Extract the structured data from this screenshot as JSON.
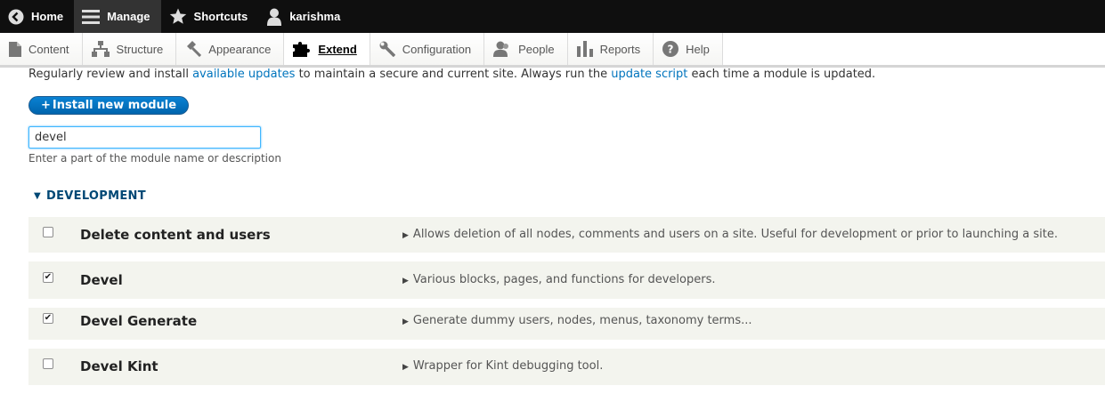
{
  "toolbar": {
    "home": "Home",
    "manage": "Manage",
    "shortcuts": "Shortcuts",
    "user": "karishma"
  },
  "tray": {
    "items": [
      {
        "label": "Content"
      },
      {
        "label": "Structure"
      },
      {
        "label": "Appearance"
      },
      {
        "label": "Extend"
      },
      {
        "label": "Configuration"
      },
      {
        "label": "People"
      },
      {
        "label": "Reports"
      },
      {
        "label": "Help"
      }
    ]
  },
  "main": {
    "desc_part1": "Regularly review and install ",
    "desc_link1": "available updates",
    "desc_part2": " to maintain a secure and current site. Always run the ",
    "desc_link2": "update script",
    "desc_part3": " each time a module is updated.",
    "install_label": "Install new module",
    "install_plus": "+",
    "filter_value": "devel",
    "filter_description": "Enter a part of the module name or description",
    "group_arrow": "▼",
    "group_title": "DEVELOPMENT"
  },
  "modules": [
    {
      "name": "Delete content and users",
      "checked": false,
      "description": "Allows deletion of all nodes, comments and users on a site. Useful for development or prior to launching a site."
    },
    {
      "name": "Devel",
      "checked": true,
      "description": "Various blocks, pages, and functions for developers."
    },
    {
      "name": "Devel Generate",
      "checked": true,
      "description": "Generate dummy users, nodes, menus, taxonomy terms..."
    },
    {
      "name": "Devel Kint",
      "checked": false,
      "description": "Wrapper for Kint debugging tool."
    }
  ],
  "colors": {
    "link": "#0074bd",
    "primary_button": "#0071c1",
    "group_title": "#004875",
    "row_bg": "#f3f4ee"
  }
}
